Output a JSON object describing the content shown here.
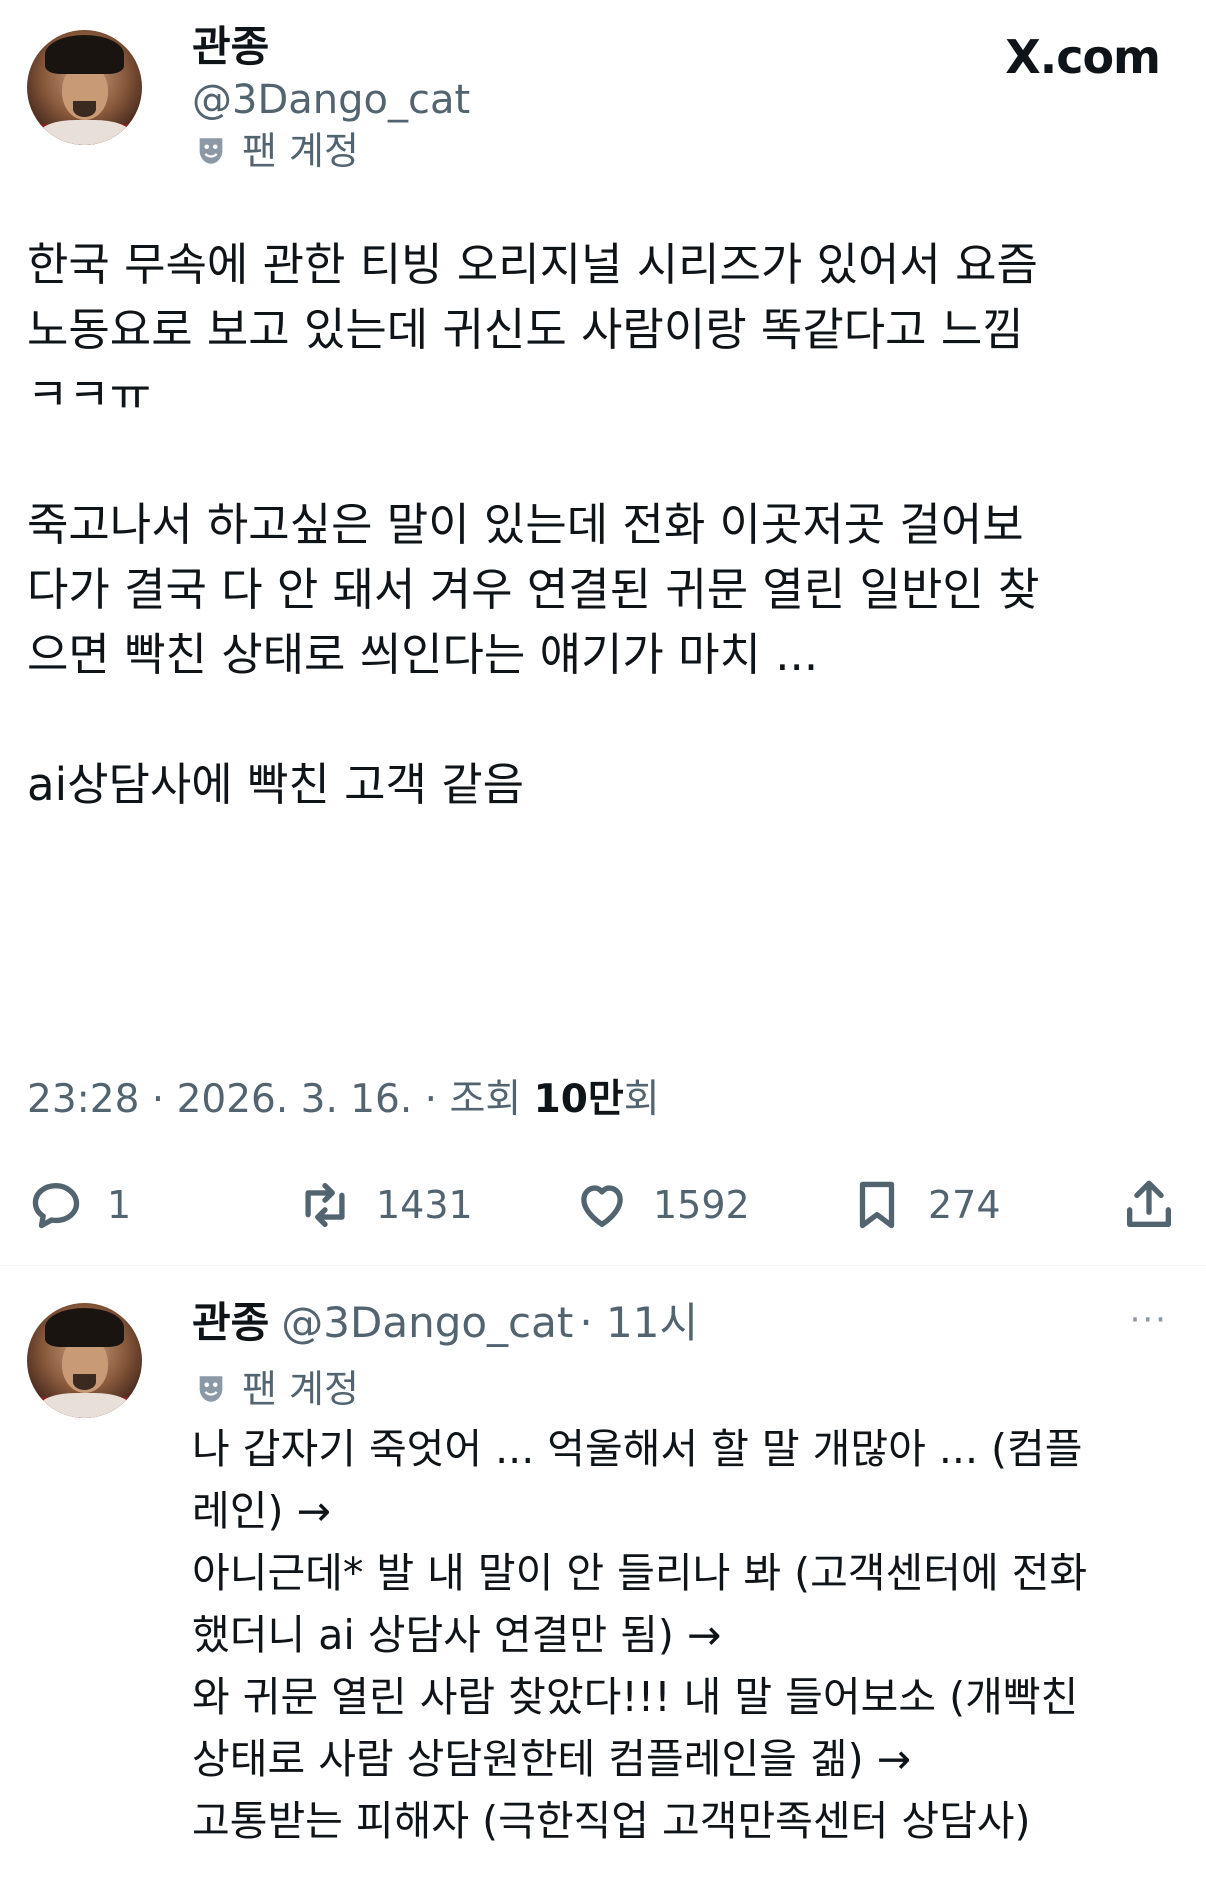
{
  "tweet": {
    "author_name": "관종",
    "author_handle": "@3Dango_cat",
    "account_badge": "팬 계정",
    "site_label": "X.com",
    "body_lines": [
      "한국 무속에 관한 티빙 오리지널 시리즈가 있어서 요즘",
      "노동요로 보고 있는데 귀신도 사람이랑 똑같다고 느낌",
      "ㅋㅋㅠ",
      "",
      "죽고나서 하고싶은 말이 있는데 전화 이곳저곳 걸어보",
      "다가 결국 다 안 돼서 겨우 연결된 귀문 열린 일반인 찾",
      "으면 빡친 상태로 씌인다는 얘기가 마치 ...",
      "",
      "ai상담사에 빡친 고객 같음"
    ],
    "timestamp": "23:28 · 2026. 3. 16. · 조회 ",
    "views": "10만",
    "views_suffix": "회",
    "actions": {
      "reply_count": "1",
      "retweet_count": "1431",
      "like_count": "1592",
      "bookmark_count": "274"
    }
  },
  "reply": {
    "author_name": "관종",
    "author_handle": "@3Dango_cat",
    "time": "· 11시",
    "account_badge": "팬 계정",
    "more": "···",
    "body_lines": [
      "나 갑자기 죽엇어 ... 억울해서 할 말 개많아 ... (컴플",
      "레인) →",
      "아니근데* 발 내 말이 안 들리나 봐 (고객센터에 전화",
      "했더니 ai 상담사 연결만 됨) →",
      "와 귀문 열린 사람 찾았다!!! 내 말 들어보소 (개빡친",
      "상태로 사람 상담원한테 컴플레인을 겖) →",
      "고통받는 피해자 (극한직업 고객만족센터 상담사)"
    ]
  }
}
